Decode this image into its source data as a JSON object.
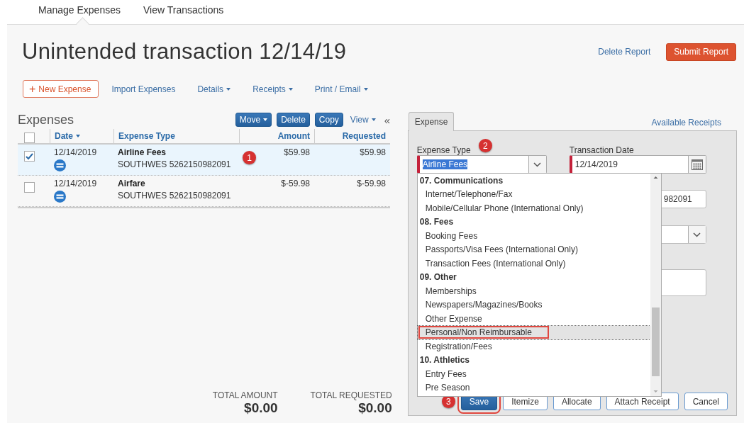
{
  "top_tabs": [
    {
      "label": "Manage Expenses",
      "selected": true
    },
    {
      "label": "View Transactions",
      "selected": false
    }
  ],
  "report": {
    "title": "Unintended transaction 12/14/19",
    "delete_link": "Delete Report",
    "submit_button": "Submit Report"
  },
  "toolbar": {
    "new_expense": {
      "icon": "+",
      "label": "New Expense"
    },
    "items": [
      {
        "label": "Import Expenses",
        "dropdown": false
      },
      {
        "label": "Details",
        "dropdown": true
      },
      {
        "label": "Receipts",
        "dropdown": true
      },
      {
        "label": "Print / Email",
        "dropdown": true
      }
    ]
  },
  "expenses": {
    "heading": "Expenses",
    "buttons": [
      {
        "label": "Move",
        "dropdown": true
      },
      {
        "label": "Delete",
        "dropdown": false
      },
      {
        "label": "Copy",
        "dropdown": false
      }
    ],
    "view": {
      "label": "View",
      "dropdown": true
    },
    "collapse": "«",
    "select_all": {
      "checked": false
    },
    "columns": [
      {
        "label": "Date",
        "sorted": true
      },
      {
        "label": "Expense Type",
        "sorted": false
      },
      {
        "label": "Amount",
        "sorted": false
      },
      {
        "label": "Requested",
        "sorted": false
      }
    ],
    "rows": [
      {
        "checked": true,
        "selected": true,
        "date": "12/14/2019",
        "type": "Airline Fees",
        "merchant": "SOUTHWES 5262150982091",
        "annotation": "1",
        "amount": "$59.98",
        "requested": "$59.98"
      },
      {
        "checked": false,
        "selected": false,
        "date": "12/14/2019",
        "type": "Airfare",
        "merchant": "SOUTHWES 5262150982091",
        "amount": "$-59.98",
        "requested": "$-59.98"
      }
    ],
    "totals": [
      {
        "label": "TOTAL AMOUNT",
        "value": "$0.00"
      },
      {
        "label": "TOTAL REQUESTED",
        "value": "$0.00"
      }
    ]
  },
  "detail": {
    "tabs": [
      {
        "label": "Expense",
        "selected": true
      }
    ],
    "available_receipts": "Available Receipts",
    "expense_type": {
      "label": "Expense Type",
      "annotation": "2",
      "value": "Airline Fees",
      "required": true,
      "text_selected": true
    },
    "transaction_date": {
      "label": "Transaction Date",
      "value": "12/14/2019",
      "required": true
    },
    "hidden_fields": [
      {
        "kind": "input",
        "value": "982091"
      },
      {
        "kind": "select"
      },
      {
        "kind": "textarea"
      }
    ],
    "dropdown": {
      "groups": [
        {
          "label": "07. Communications",
          "options": [
            {
              "label": "Internet/Telephone/Fax",
              "selected": false,
              "annotated": false
            },
            {
              "label": "Mobile/Cellular Phone (International Only)",
              "selected": false,
              "annotated": false
            }
          ]
        },
        {
          "label": "08. Fees",
          "options": [
            {
              "label": "Booking Fees",
              "selected": false,
              "annotated": false
            },
            {
              "label": "Passports/Visa Fees (International Only)",
              "selected": false,
              "annotated": false
            },
            {
              "label": "Transaction Fees (International Only)",
              "selected": false,
              "annotated": false
            }
          ]
        },
        {
          "label": "09. Other",
          "options": [
            {
              "label": "Memberships",
              "selected": false,
              "annotated": false
            },
            {
              "label": "Newspapers/Magazines/Books",
              "selected": false,
              "annotated": false
            },
            {
              "label": "Other Expense",
              "selected": false,
              "annotated": false
            },
            {
              "label": "Personal/Non Reimbursable",
              "selected": true,
              "annotated": true
            },
            {
              "label": "Registration/Fees",
              "selected": false,
              "annotated": false
            }
          ]
        },
        {
          "label": "10. Athletics",
          "options": [
            {
              "label": "Entry Fees",
              "selected": false,
              "annotated": false
            },
            {
              "label": "Pre Season",
              "selected": false,
              "annotated": false
            }
          ]
        }
      ]
    },
    "buttons": [
      {
        "label": "Save",
        "primary": true,
        "annotation": "3"
      },
      {
        "label": "Itemize",
        "primary": false
      },
      {
        "label": "Allocate",
        "primary": false
      },
      {
        "label": "Attach Receipt",
        "primary": false
      },
      {
        "label": "Cancel",
        "primary": false
      }
    ]
  }
}
